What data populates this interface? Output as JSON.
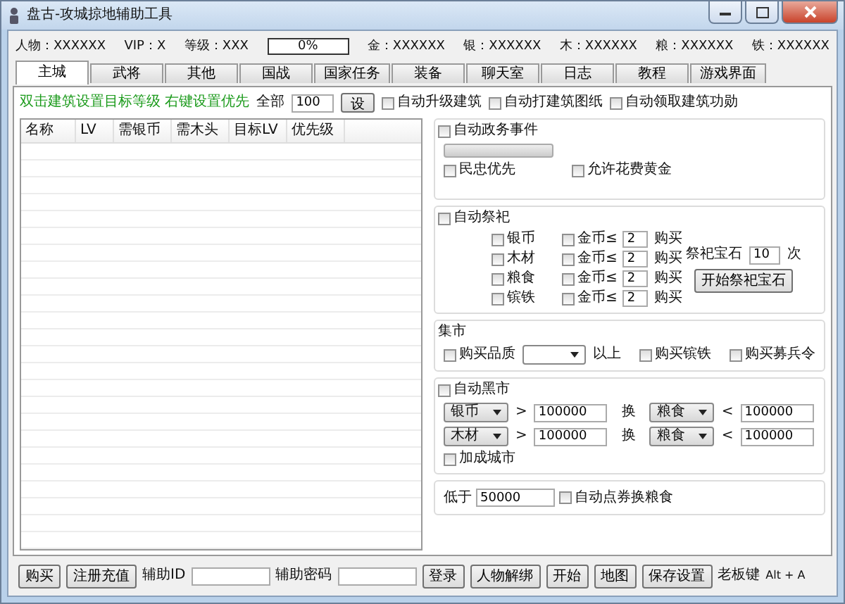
{
  "window": {
    "title": "盘古-攻城掠地辅助工具"
  },
  "stats": [
    {
      "kind": "stat",
      "label": "人物：",
      "value": "XXXXXX"
    },
    {
      "kind": "stat",
      "label": "VIP：",
      "value": "X"
    },
    {
      "kind": "stat",
      "label": "等级：",
      "value": "XXX"
    },
    {
      "kind": "progress",
      "level": 0,
      "text": "0%"
    },
    {
      "kind": "stat",
      "label": "金：",
      "value": "XXXXXX"
    },
    {
      "kind": "stat",
      "label": "银：",
      "value": "XXXXXX"
    },
    {
      "kind": "stat",
      "label": "木：",
      "value": "XXXXXX"
    },
    {
      "kind": "stat",
      "label": "粮：",
      "value": "XXXXXX"
    },
    {
      "kind": "stat",
      "label": "铁：",
      "value": "XXXXXX"
    }
  ],
  "tabs": [
    {
      "label": "主城",
      "selected": true
    },
    {
      "label": "武将",
      "selected": false
    },
    {
      "label": "其他",
      "selected": false
    },
    {
      "label": "国战",
      "selected": false
    },
    {
      "label": "国家任务",
      "selected": false
    },
    {
      "label": "装备",
      "selected": false
    },
    {
      "label": "聊天室",
      "selected": false
    },
    {
      "label": "日志",
      "selected": false
    },
    {
      "label": "教程",
      "selected": false
    },
    {
      "label": "游戏界面",
      "selected": false
    }
  ],
  "toolbar": {
    "hint": "双击建筑设置目标等级 右键设置优先",
    "all_label": "全部",
    "all_value": "100",
    "set_button": "设",
    "checks": [
      {
        "label": "自动升级建筑",
        "checked": false
      },
      {
        "label": "自动打建筑图纸",
        "checked": false
      },
      {
        "label": "自动领取建筑功勋",
        "checked": false
      }
    ]
  },
  "table": {
    "columns": [
      "名称",
      "LV",
      "需银币",
      "需木头",
      "目标LV",
      "优先级"
    ]
  },
  "affairs": {
    "title": "自动政务事件",
    "checked": false,
    "options": [
      {
        "label": "民忠优先",
        "checked": false
      },
      {
        "label": "允许花费黄金",
        "checked": false
      }
    ]
  },
  "sacrifice": {
    "title": "自动祭祀",
    "checked": false,
    "rows": [
      {
        "label": "银币",
        "checked": false,
        "gold_label": "金币≤",
        "gold_checked": false,
        "value": "2",
        "action": "购买"
      },
      {
        "label": "木材",
        "checked": false,
        "gold_label": "金币≤",
        "gold_checked": false,
        "value": "2",
        "action": "购买"
      },
      {
        "label": "粮食",
        "checked": false,
        "gold_label": "金币≤",
        "gold_checked": false,
        "value": "2",
        "action": "购买"
      },
      {
        "label": "镔铁",
        "checked": false,
        "gold_label": "金币≤",
        "gold_checked": false,
        "value": "2",
        "action": "购买"
      }
    ],
    "gem_label": "祭祀宝石",
    "gem_value": "10",
    "gem_unit": "次",
    "gem_button": "开始祭祀宝石"
  },
  "market": {
    "title": "集市",
    "quality": {
      "label": "购买品质",
      "checked": false,
      "suffix": "以上"
    },
    "options": [
      {
        "label": "购买镔铁",
        "checked": false
      },
      {
        "label": "购买募兵令",
        "checked": false
      }
    ]
  },
  "black_market": {
    "title": "自动黑市",
    "checked": false,
    "rows": [
      {
        "from": "银币",
        "gt": ">",
        "amount": "100000",
        "swap": "换",
        "to": "粮食",
        "lt": "<",
        "limit": "100000"
      },
      {
        "from": "木材",
        "gt": ">",
        "amount": "100000",
        "swap": "换",
        "to": "粮食",
        "lt": "<",
        "limit": "100000"
      }
    ],
    "bonus": {
      "label": "加成城市",
      "checked": false
    }
  },
  "low": {
    "label": "低于",
    "value": "50000",
    "check": {
      "label": "自动点券换粮食",
      "checked": false
    }
  },
  "bottom": {
    "buy": "购买",
    "register": "注册充值",
    "id_label": "辅助ID",
    "pwd_label": "辅助密码",
    "buttons": [
      "登录",
      "人物解绑",
      "开始",
      "地图",
      "保存设置"
    ],
    "boss_key_label": "老板键",
    "boss_key": "Alt + A"
  }
}
